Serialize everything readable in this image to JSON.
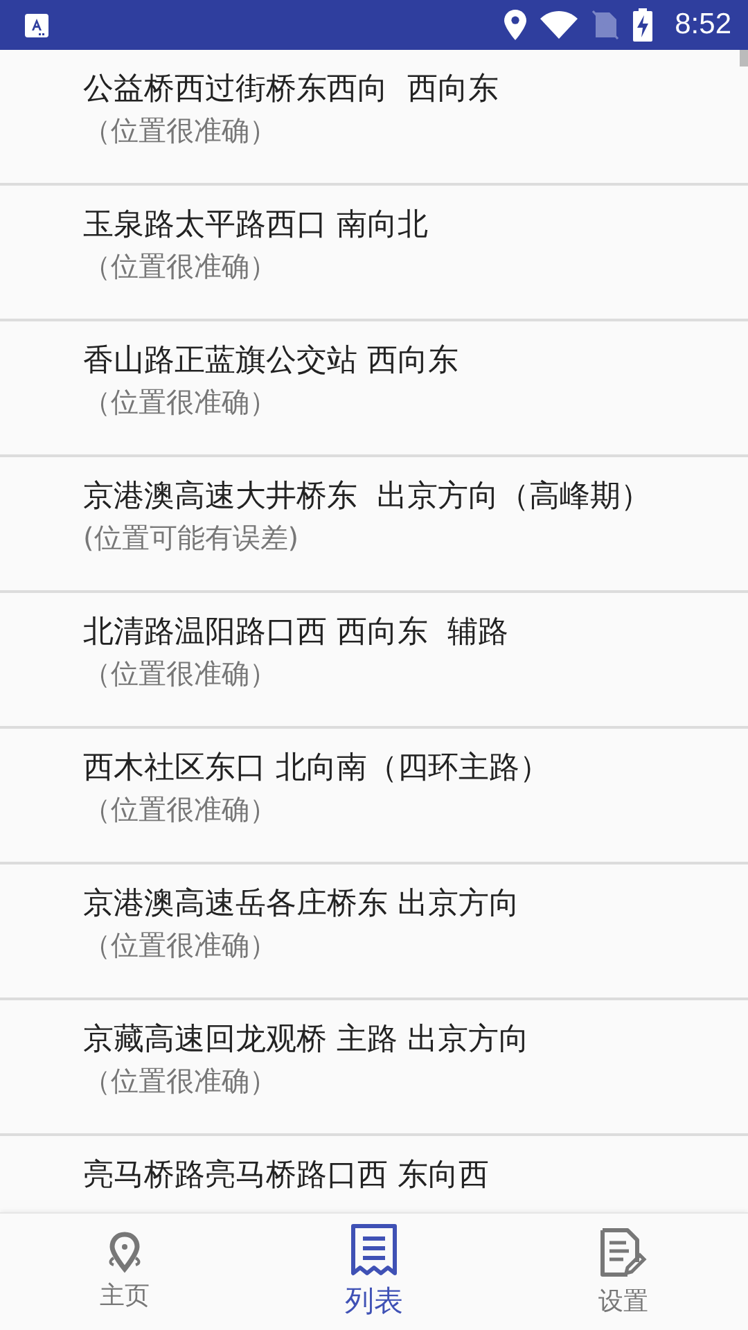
{
  "status_bar": {
    "time": "8:52"
  },
  "locations": [
    {
      "title": "公益桥西过街桥东西向  西向东",
      "note": "（位置很准确）"
    },
    {
      "title": "玉泉路太平路西口 南向北",
      "note": "（位置很准确）"
    },
    {
      "title": "香山路正蓝旗公交站 西向东",
      "note": "（位置很准确）"
    },
    {
      "title": "京港澳高速大井桥东  出京方向（高峰期）",
      "note": "(位置可能有误差)"
    },
    {
      "title": "北清路温阳路口西 西向东  辅路",
      "note": "（位置很准确）"
    },
    {
      "title": "西木社区东口 北向南（四环主路）",
      "note": "（位置很准确）"
    },
    {
      "title": "京港澳高速岳各庄桥东 出京方向",
      "note": "（位置很准确）"
    },
    {
      "title": "京藏高速回龙观桥 主路 出京方向",
      "note": "（位置很准确）"
    },
    {
      "title": "亮马桥路亮马桥路口西 东向西"
    }
  ],
  "bottom_nav": [
    {
      "kind": "home",
      "label": "主页",
      "selected": false
    },
    {
      "kind": "list",
      "label": "列表",
      "selected": true
    },
    {
      "kind": "settings",
      "label": "设置",
      "selected": false
    }
  ]
}
